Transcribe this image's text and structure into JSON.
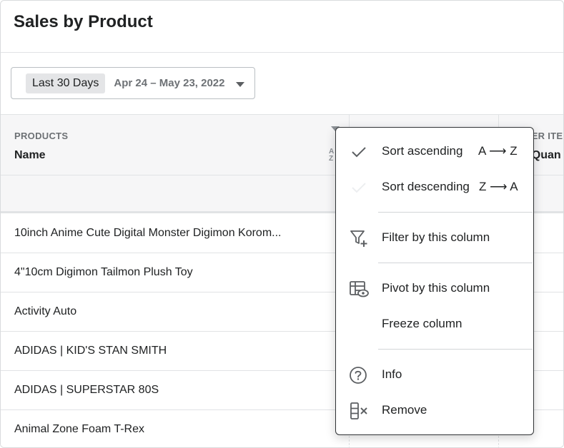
{
  "page": {
    "title": "Sales by Product"
  },
  "date_picker": {
    "preset": "Last 30 Days",
    "range": "Apr 24 – May 23, 2022"
  },
  "table": {
    "columns": [
      {
        "group": "PRODUCTS",
        "name": "Name"
      },
      {
        "group": "DER ITE",
        "name": "t Quan"
      }
    ],
    "sort_icon_text": "A\nZ",
    "rows": [
      "10inch Anime Cute Digital Monster Digimon Korom...",
      "4\"10cm Digimon Tailmon Plush Toy",
      "Activity Auto",
      "ADIDAS | KID'S STAN SMITH",
      "ADIDAS | SUPERSTAR 80S",
      "Animal Zone Foam T-Rex"
    ]
  },
  "menu": {
    "sort_ascending": {
      "label": "Sort ascending",
      "shortcut": "A ⟶ Z",
      "icon": "check-icon"
    },
    "sort_descending": {
      "label": "Sort descending",
      "shortcut": "Z ⟶ A",
      "icon": "check-icon"
    },
    "filter": {
      "label": "Filter by this column",
      "icon": "filter-add-icon"
    },
    "pivot": {
      "label": "Pivot by this column",
      "icon": "pivot-table-eye-icon"
    },
    "freeze": {
      "label": "Freeze column"
    },
    "info": {
      "label": "Info",
      "icon": "question-circle-icon"
    },
    "remove": {
      "label": "Remove",
      "icon": "remove-column-icon"
    }
  },
  "colors": {
    "icon": "#5c5f62",
    "check_active": "#5c5f62",
    "check_inactive": "#e4e5e7",
    "header_bg": "#f6f6f7"
  }
}
